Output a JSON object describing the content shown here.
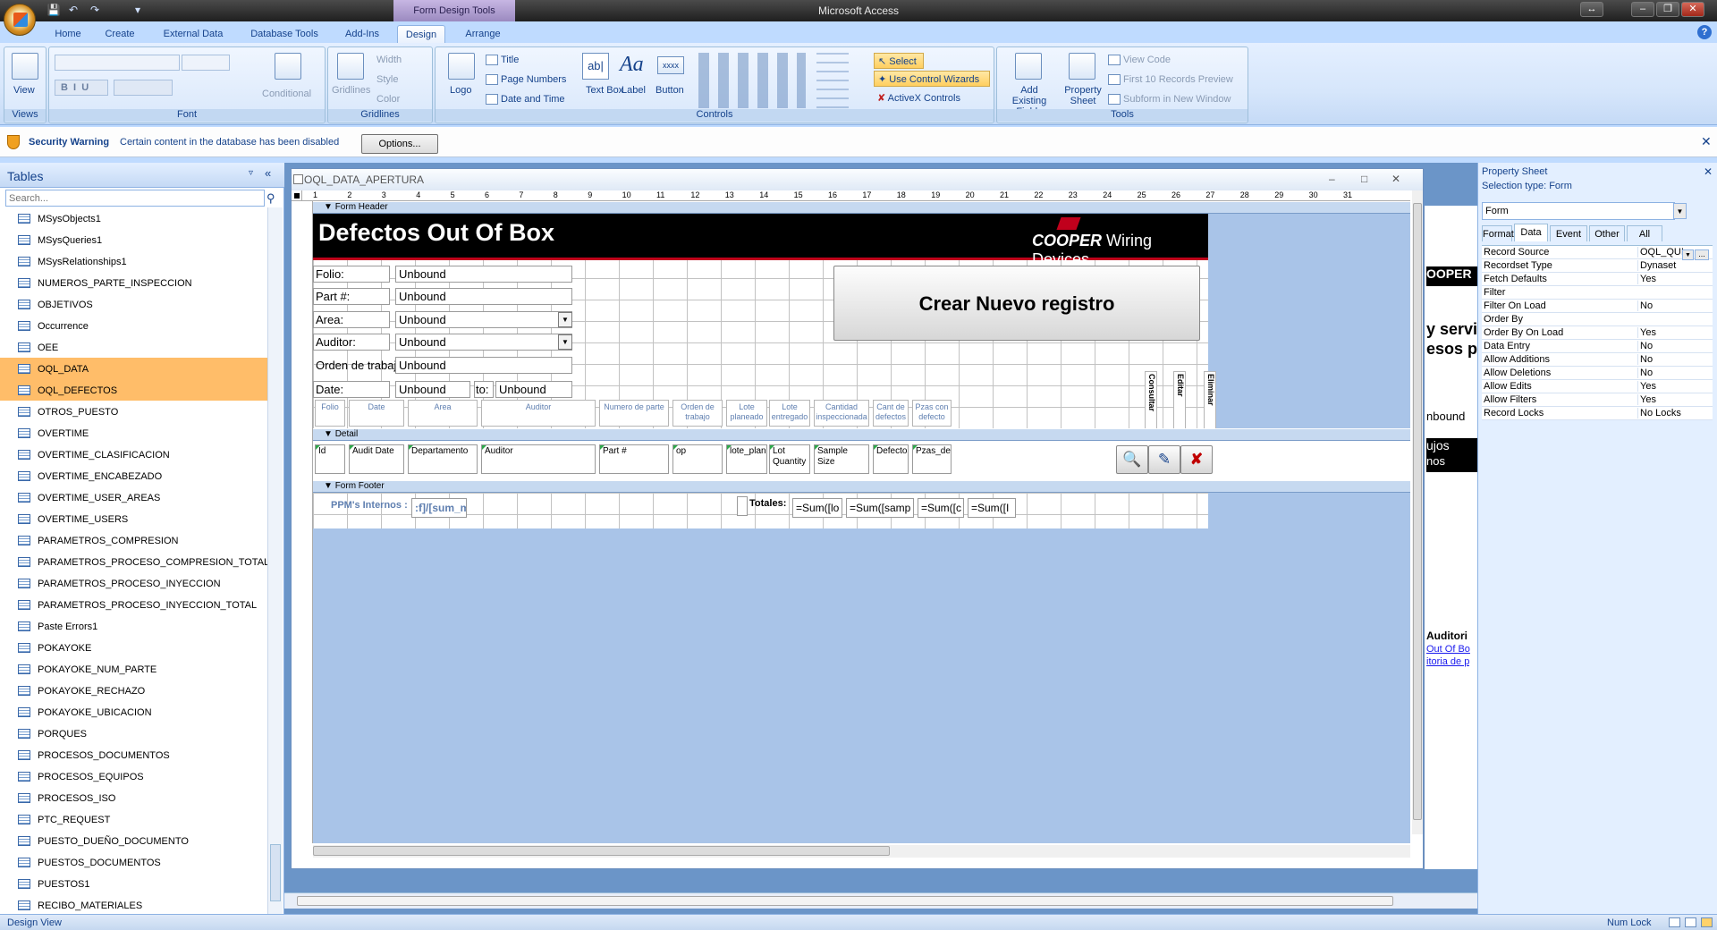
{
  "window": {
    "app_title": "Microsoft Access",
    "context_tab": "Form Design Tools"
  },
  "tabs": [
    "Home",
    "Create",
    "External Data",
    "Database Tools",
    "Add-Ins",
    "Design",
    "Arrange"
  ],
  "ribbon": {
    "views": {
      "view_label": "View",
      "group": "Views"
    },
    "font": {
      "group": "Font",
      "conditional": "Conditional"
    },
    "gridlines": {
      "group": "Gridlines",
      "gridlines": "Gridlines",
      "width": "Width",
      "style": "Style",
      "color": "Color"
    },
    "controls": {
      "group": "Controls",
      "logo": "Logo",
      "title": "Title",
      "page_numbers": "Page Numbers",
      "date_time": "Date and Time",
      "text_box": "Text Box",
      "label": "Label",
      "button": "Button",
      "select": "Select",
      "use_wizards": "Use Control Wizards",
      "activex": "ActiveX Controls"
    },
    "tools": {
      "group": "Tools",
      "add_existing": "Add Existing Fields",
      "property_sheet": "Property Sheet",
      "view_code": "View Code",
      "first10": "First 10 Records Preview",
      "subform": "Subform in New Window"
    }
  },
  "security": {
    "title": "Security Warning",
    "message": "Certain content in the database has been disabled",
    "options": "Options..."
  },
  "nav": {
    "title": "Tables",
    "search_placeholder": "Search...",
    "items": [
      "MSysObjects1",
      "MSysQueries1",
      "MSysRelationships1",
      "NUMEROS_PARTE_INSPECCION",
      "OBJETIVOS",
      "Occurrence",
      "OEE",
      "OQL_DATA",
      "OQL_DEFECTOS",
      "OTROS_PUESTO",
      "OVERTIME",
      "OVERTIME_CLASIFICACION",
      "OVERTIME_ENCABEZADO",
      "OVERTIME_USER_AREAS",
      "OVERTIME_USERS",
      "PARAMETROS_COMPRESION",
      "PARAMETROS_PROCESO_COMPRESION_TOTAL",
      "PARAMETROS_PROCESO_INYECCION",
      "PARAMETROS_PROCESO_INYECCION_TOTAL",
      "Paste Errors1",
      "POKAYOKE",
      "POKAYOKE_NUM_PARTE",
      "POKAYOKE_RECHAZO",
      "POKAYOKE_UBICACION",
      "PORQUES",
      "PROCESOS_DOCUMENTOS",
      "PROCESOS_EQUIPOS",
      "PROCESOS_ISO",
      "PTC_REQUEST",
      "PUESTO_DUEÑO_DOCUMENTO",
      "PUESTOS_DOCUMENTOS",
      "PUESTOS1",
      "RECIBO_MATERIALES"
    ],
    "selected": [
      "OQL_DATA",
      "OQL_DEFECTOS"
    ]
  },
  "form": {
    "window_title": "OQL_DATA_APERTURA",
    "header_section": "Form Header",
    "detail_section": "Detail",
    "footer_section": "Form Footer",
    "banner_title": "Defectos Out Of Box",
    "brand_bold": "COOPER",
    "brand_rest": " Wiring Devices",
    "create_button": "Crear Nuevo registro",
    "fields": [
      {
        "label": "Folio:",
        "value": "Unbound"
      },
      {
        "label": "Part #:",
        "value": "Unbound"
      },
      {
        "label": "Area:",
        "value": "Unbound"
      },
      {
        "label": "Auditor:",
        "value": "Unbound"
      },
      {
        "label": "Orden de trabajo:",
        "value": "Unbound"
      },
      {
        "label": "Date:",
        "value": "Unbound"
      }
    ],
    "to_label": "to:",
    "to_value": "Unbound",
    "column_headers": [
      "Folio",
      "Date",
      "Area",
      "Auditor",
      "Numero de parte",
      "Orden de trabajo",
      "Lote planeado",
      "Lote entregado",
      "Cantidad inspeccionada",
      "Cant de defectos",
      "Pzas con defecto"
    ],
    "vertical_headers": [
      "Consultar",
      "Editar",
      "Eliminar"
    ],
    "detail_fields": [
      "Id",
      "Audit Date",
      "Departamento",
      "Auditor",
      "Part #",
      "op",
      "lote_planeado",
      "Lot Quantity",
      "Sample Size",
      "Defectos",
      "Pzas_defectuos"
    ],
    "footer": {
      "ppm_label": "PPM's Internos :",
      "ppm_value": ":f]/[sum_mu",
      "totales_label": "Totales:",
      "sums": [
        "=Sum([lo",
        "=Sum([samp",
        "=Sum([c",
        "=Sum([I"
      ]
    },
    "ruler_numbers": [
      "1",
      "2",
      "3",
      "4",
      "5",
      "6",
      "7",
      "8",
      "9",
      "10",
      "11",
      "12",
      "13",
      "14",
      "15",
      "16",
      "17",
      "18",
      "19",
      "20",
      "21",
      "22",
      "23",
      "24",
      "25",
      "26",
      "27",
      "28",
      "29",
      "30",
      "31"
    ]
  },
  "bg_form": {
    "snippets": [
      "OOPER",
      "y servi",
      "esos p",
      "nbound",
      "ujos",
      "nos",
      "Auditori",
      "Out Of Bo",
      "itoria de p"
    ]
  },
  "property_sheet": {
    "title": "Property Sheet",
    "selection_type": "Selection type:  Form",
    "combo_value": "Form",
    "tabs": [
      "Format",
      "Data",
      "Event",
      "Other",
      "All"
    ],
    "active_tab": "Data",
    "rows": [
      {
        "k": "Record Source",
        "v": "OQL_QUI"
      },
      {
        "k": "Recordset Type",
        "v": "Dynaset"
      },
      {
        "k": "Fetch Defaults",
        "v": "Yes"
      },
      {
        "k": "Filter",
        "v": ""
      },
      {
        "k": "Filter On Load",
        "v": "No"
      },
      {
        "k": "Order By",
        "v": ""
      },
      {
        "k": "Order By On Load",
        "v": "Yes"
      },
      {
        "k": "Data Entry",
        "v": "No"
      },
      {
        "k": "Allow Additions",
        "v": "No"
      },
      {
        "k": "Allow Deletions",
        "v": "No"
      },
      {
        "k": "Allow Edits",
        "v": "Yes"
      },
      {
        "k": "Allow Filters",
        "v": "Yes"
      },
      {
        "k": "Record Locks",
        "v": "No Locks"
      }
    ]
  },
  "status": {
    "left": "Design View",
    "num_lock": "Num Lock"
  }
}
